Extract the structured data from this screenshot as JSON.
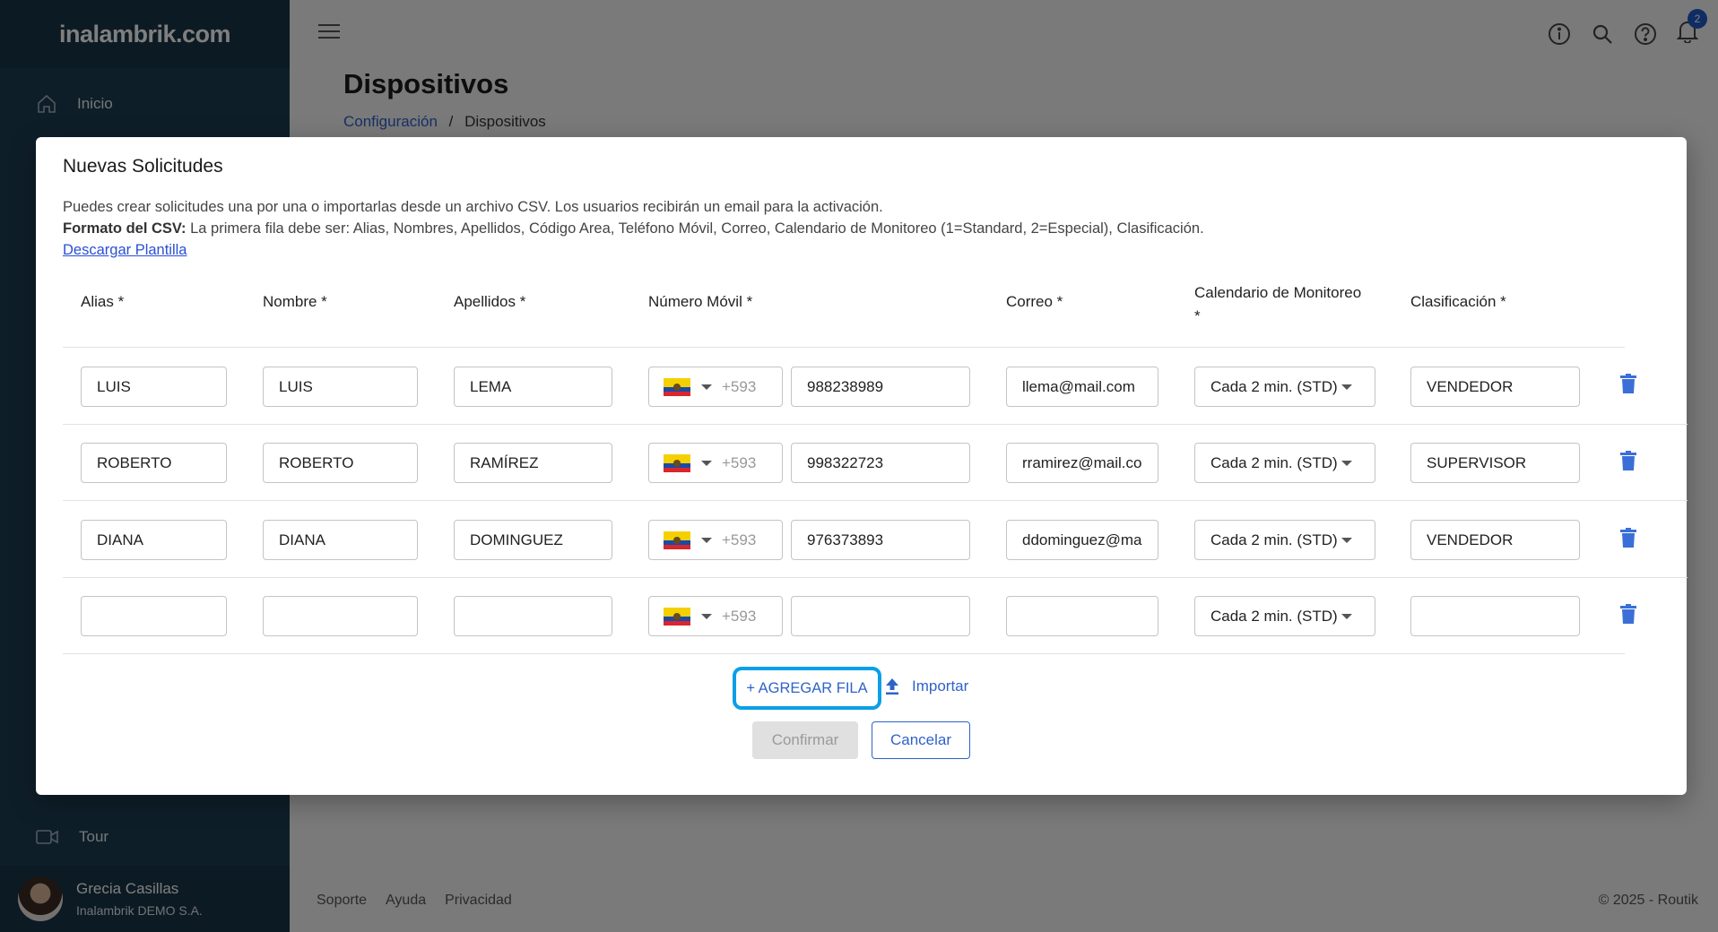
{
  "sidebar": {
    "logo_text": "inalambrik.com",
    "items": [
      {
        "label": "Inicio",
        "icon": "home-icon"
      },
      {
        "label": "Tour",
        "icon": "video-camera-icon"
      }
    ],
    "user": {
      "name": "Grecia Casillas",
      "company": "Inalambrik DEMO S.A."
    }
  },
  "topbar": {
    "notification_count": "2"
  },
  "page": {
    "title": "Dispositivos",
    "breadcrumb": {
      "parent": "Configuración",
      "separator": "/",
      "current": "Dispositivos"
    }
  },
  "footer": {
    "links": [
      "Soporte",
      "Ayuda",
      "Privacidad"
    ],
    "copyright": "© 2025 - Routik"
  },
  "modal": {
    "title": "Nuevas Solicitudes",
    "description": "Puedes crear solicitudes una por una o importarlas desde un archivo CSV. Los usuarios recibirán un email para la activación.",
    "csv_format_label": "Formato del CSV:",
    "csv_format_text": " La primera fila debe ser: Alias, Nombres, Apellidos, Código Area, Teléfono Móvil, Correo, Calendario de Monitoreo (1=Standard, 2=Especial), Clasificación.",
    "download_link": "Descargar Plantilla",
    "columns": {
      "alias": "Alias *",
      "nombre": "Nombre *",
      "apellidos": "Apellidos *",
      "movil": "Número Móvil *",
      "correo": "Correo *",
      "calendario": "Calendario de Monitoreo",
      "calendario_req": "*",
      "clasificacion": "Clasificación *"
    },
    "rows": [
      {
        "alias": "LUIS",
        "nombre": "LUIS",
        "apellidos": "LEMA",
        "code": "+593",
        "movil": "988238989",
        "correo": "llema@mail.com",
        "calendario": "Cada 2 min. (STD)",
        "clasificacion": "VENDEDOR"
      },
      {
        "alias": "ROBERTO",
        "nombre": "ROBERTO",
        "apellidos": "RAMÍREZ",
        "code": "+593",
        "movil": "998322723",
        "correo": "rramirez@mail.co",
        "calendario": "Cada 2 min. (STD)",
        "clasificacion": "SUPERVISOR"
      },
      {
        "alias": "DIANA",
        "nombre": "DIANA",
        "apellidos": "DOMINGUEZ",
        "code": "+593",
        "movil": "976373893",
        "correo": "ddominguez@ma",
        "calendario": "Cada 2 min. (STD)",
        "clasificacion": "VENDEDOR"
      },
      {
        "alias": "",
        "nombre": "",
        "apellidos": "",
        "code": "+593",
        "movil": "",
        "correo": "",
        "calendario": "Cada 2 min. (STD)",
        "clasificacion": ""
      }
    ],
    "add_row_label": "+ AGREGAR FILA",
    "import_label": "Importar",
    "confirm_label": "Confirmar",
    "cancel_label": "Cancelar"
  },
  "colors": {
    "sidebar": "#1d3d52",
    "accent": "#2f63c9",
    "highlight": "#0aa0e6",
    "trash": "#3b6fd8"
  }
}
